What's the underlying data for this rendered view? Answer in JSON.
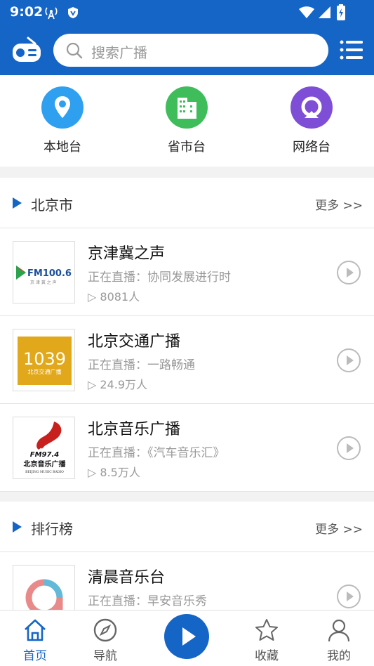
{
  "status": {
    "time": "9:02"
  },
  "search": {
    "placeholder": "搜索广播"
  },
  "categories": [
    {
      "label": "本地台",
      "color": "#2f9ff0",
      "icon": "location-pin-icon"
    },
    {
      "label": "省市台",
      "color": "#3fbd5b",
      "icon": "buildings-icon"
    },
    {
      "label": "网络台",
      "color": "#7e4ed6",
      "icon": "broadcast-icon"
    }
  ],
  "sections": [
    {
      "title": "北京市",
      "more": "更多 >>",
      "items": [
        {
          "name": "京津冀之声",
          "live": "正在直播：协同发展进行时",
          "listeners": "▷ 8081人",
          "logo_text": "FM100.6",
          "logo_sub": "京 津 冀 之 声"
        },
        {
          "name": "北京交通广播",
          "live": "正在直播：一路畅通",
          "listeners": "▷ 24.9万人",
          "logo_text": "1039",
          "logo_sub": "北京交通广播"
        },
        {
          "name": "北京音乐广播",
          "live": "正在直播：《汽车音乐汇》",
          "listeners": "▷ 8.5万人",
          "logo_text": "FM97.4",
          "logo_sub": "北京音乐广播",
          "logo_sub2": "BEIJING MUSIC RADIO"
        }
      ]
    },
    {
      "title": "排行榜",
      "more": "更多 >>",
      "items": [
        {
          "name": "清晨音乐台",
          "live": "正在直播：早安音乐秀",
          "listeners": ""
        }
      ]
    }
  ],
  "tabs": [
    {
      "label": "首页",
      "active": true
    },
    {
      "label": "导航",
      "active": false
    },
    {
      "label": "收藏",
      "active": false
    },
    {
      "label": "我的",
      "active": false
    }
  ],
  "colors": {
    "primary": "#1565c6",
    "logo_orange": "#e2a81c",
    "logo_red": "#c8201d"
  }
}
